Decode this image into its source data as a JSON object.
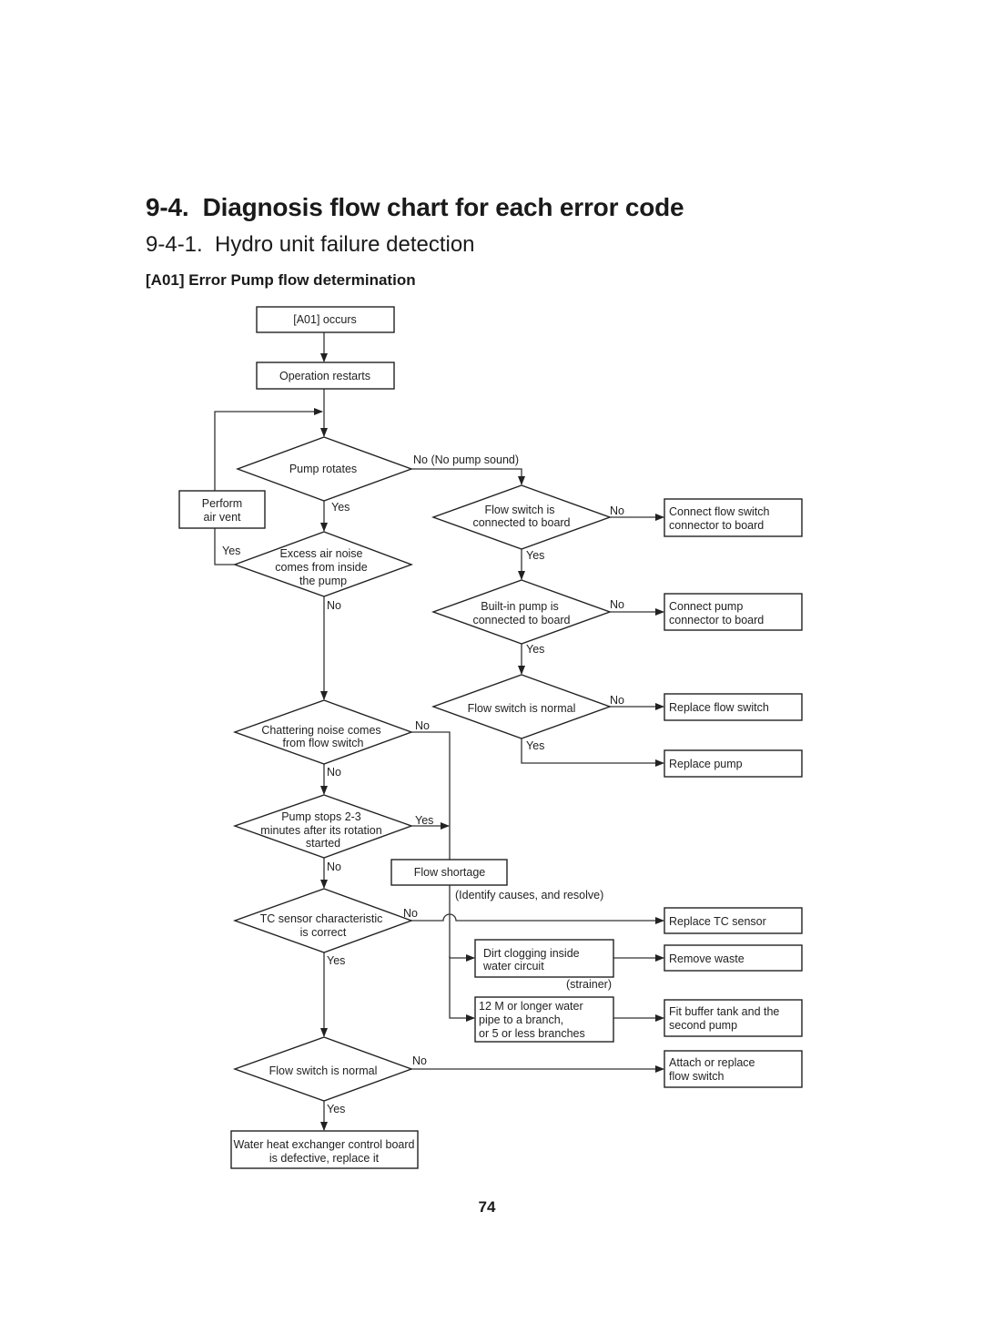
{
  "page": {
    "section_title": "9-4.  Diagnosis flow chart for each error code",
    "subsection_title": "9-4-1.  Hydro unit failure detection",
    "chart_heading": "[A01] Error Pump flow determination",
    "page_number": "74"
  },
  "flowchart": {
    "nodes": {
      "start": [
        "[A01] occurs"
      ],
      "restart": [
        "Operation restarts"
      ],
      "pump_rotates": [
        "Pump rotates"
      ],
      "air_vent": [
        "Perform",
        "air vent"
      ],
      "air_noise": [
        "Excess air noise",
        "comes from inside",
        "the pump"
      ],
      "fs_connected": [
        "Flow switch is",
        "connected to board"
      ],
      "connect_fs": [
        "Connect flow switch",
        "connector to board"
      ],
      "pump_connected": [
        "Built-in pump is",
        "connected to board"
      ],
      "connect_pump": [
        "Connect pump",
        "connector to board"
      ],
      "fs_normal_1": [
        "Flow switch is normal"
      ],
      "replace_fs": [
        "Replace flow switch"
      ],
      "replace_pump": [
        "Replace pump"
      ],
      "chattering": [
        "Chattering noise comes",
        "from flow switch"
      ],
      "pump_stops": [
        "Pump stops 2-3",
        "minutes after its rotation",
        "started"
      ],
      "flow_shortage": [
        "Flow shortage"
      ],
      "tc_sensor": [
        "TC sensor characteristic",
        "is correct"
      ],
      "replace_tc": [
        "Replace TC sensor"
      ],
      "dirt": [
        "Dirt clogging inside",
        "water circuit"
      ],
      "remove_waste": [
        "Remove waste"
      ],
      "pipe": [
        "12 M or longer water",
        "pipe to a branch,",
        "or 5 or less branches"
      ],
      "buffer": [
        "Fit buffer tank and the",
        "second pump"
      ],
      "fs_normal_2": [
        "Flow switch is normal"
      ],
      "attach_fs": [
        "Attach or replace",
        "flow switch"
      ],
      "board": [
        "Water heat exchanger control board",
        "is defective, replace it"
      ]
    },
    "labels": {
      "no_pump_sound": "No (No pump sound)",
      "yes_pump_rotates": "Yes",
      "yes_air_noise": "Yes",
      "no_air_noise": "No",
      "no_fs_connected": "No",
      "yes_fs_connected": "Yes",
      "no_pump_connected": "No",
      "yes_pump_connected": "Yes",
      "no_fs_normal_1": "No",
      "yes_fs_normal_1": "Yes",
      "no_chattering_right": "No",
      "no_chattering_down": "No",
      "yes_pump_stops": "Yes",
      "no_pump_stops": "No",
      "identify_causes": "(Identify causes, and resolve)",
      "no_tc": "No",
      "yes_tc": "Yes",
      "strainer": "(strainer)",
      "no_fs_normal_2": "No",
      "yes_fs_normal_2": "Yes"
    }
  }
}
